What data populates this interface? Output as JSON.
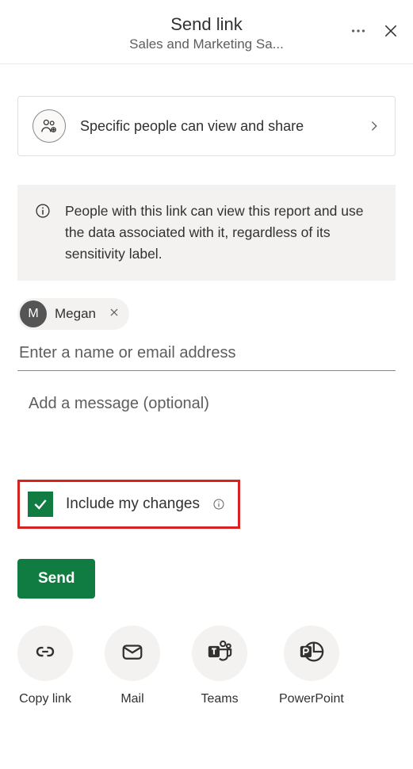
{
  "header": {
    "title": "Send link",
    "subtitle": "Sales and Marketing Sa..."
  },
  "linkSettings": {
    "text": "Specific people can view and share"
  },
  "infoBox": {
    "text": "People with this link can view this report and use the data associated with it, regardless of its sensitivity label."
  },
  "recipient": {
    "initial": "M",
    "name": "Megan"
  },
  "nameInput": {
    "placeholder": "Enter a name or email address"
  },
  "messageInput": {
    "placeholder": "Add a message (optional)"
  },
  "checkbox": {
    "label": "Include my changes",
    "checked": true
  },
  "sendButton": {
    "label": "Send"
  },
  "shareOptions": {
    "copyLink": "Copy link",
    "mail": "Mail",
    "teams": "Teams",
    "powerpoint": "PowerPoint"
  }
}
